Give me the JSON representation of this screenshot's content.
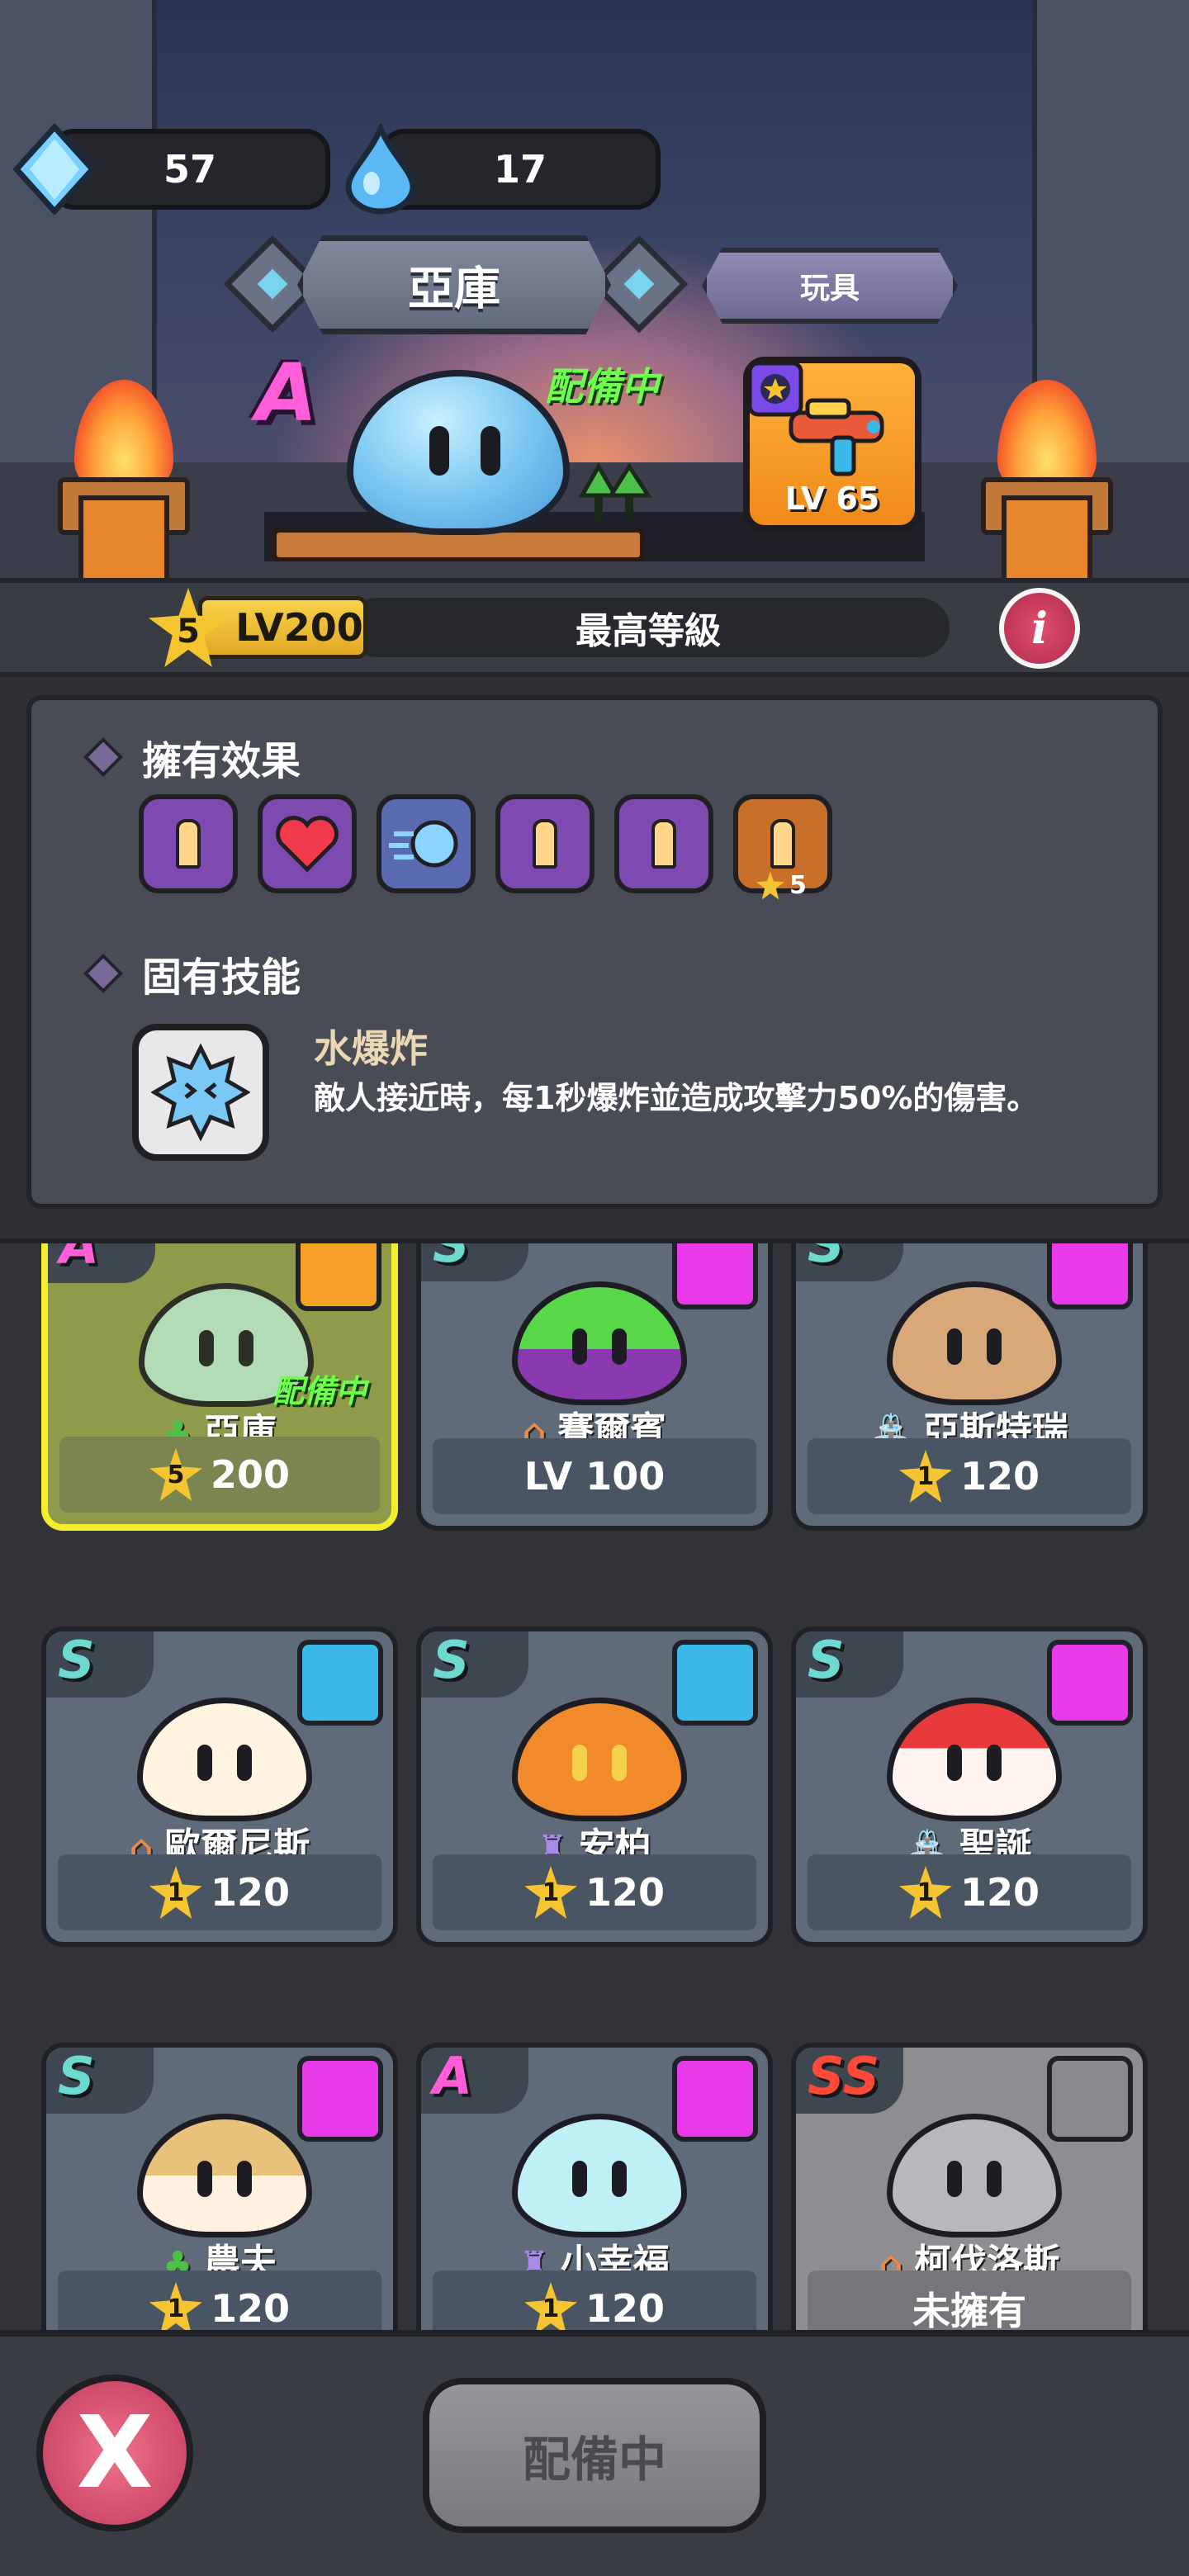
{
  "resources": {
    "crystals": "57",
    "drops": "17"
  },
  "header": {
    "hero_name": "亞庫",
    "toy_tab": "玩具"
  },
  "hero": {
    "grade": "A",
    "status": "配備中",
    "toy_level": "LV 65",
    "stars": "5",
    "level": "LV200",
    "progress_text": "最高等級"
  },
  "effects": {
    "title": "擁有效果",
    "items": [
      {
        "icon": "sword-icon",
        "color": "#7d4ab0"
      },
      {
        "icon": "heart-icon",
        "color": "#7d4ab0"
      },
      {
        "icon": "speed-icon",
        "color": "#7d4ab0"
      },
      {
        "icon": "sword-icon",
        "color": "#7d4ab0"
      },
      {
        "icon": "sword-icon",
        "color": "#7d4ab0"
      },
      {
        "icon": "sword-icon",
        "color": "#c8702a",
        "stars": "5"
      }
    ]
  },
  "skill": {
    "title": "固有技能",
    "name": "水爆炸",
    "desc": "敵人接近時，每1秒爆炸並造成攻擊力50%的傷害。"
  },
  "cards": [
    {
      "grade": "A",
      "name": "亞庫",
      "stars": "5",
      "level": "200",
      "status": "配備中"
    },
    {
      "grade": "S",
      "name": "賽爾賓",
      "level_text": "LV 100"
    },
    {
      "grade": "S",
      "name": "亞斯特瑞",
      "stars": "1",
      "level": "120"
    },
    {
      "grade": "S",
      "name": "歐爾尼斯",
      "stars": "1",
      "level": "120"
    },
    {
      "grade": "S",
      "name": "安柏",
      "stars": "1",
      "level": "120"
    },
    {
      "grade": "S",
      "name": "聖誕",
      "stars": "1",
      "level": "120"
    },
    {
      "grade": "S",
      "name": "農夫",
      "stars": "1",
      "level": "120"
    },
    {
      "grade": "A",
      "name": "小幸福",
      "stars": "1",
      "level": "120"
    },
    {
      "grade": "SS",
      "name": "柯伐洛斯",
      "level_text": "未擁有"
    }
  ],
  "footer": {
    "close": "X",
    "equip": "配備中"
  }
}
